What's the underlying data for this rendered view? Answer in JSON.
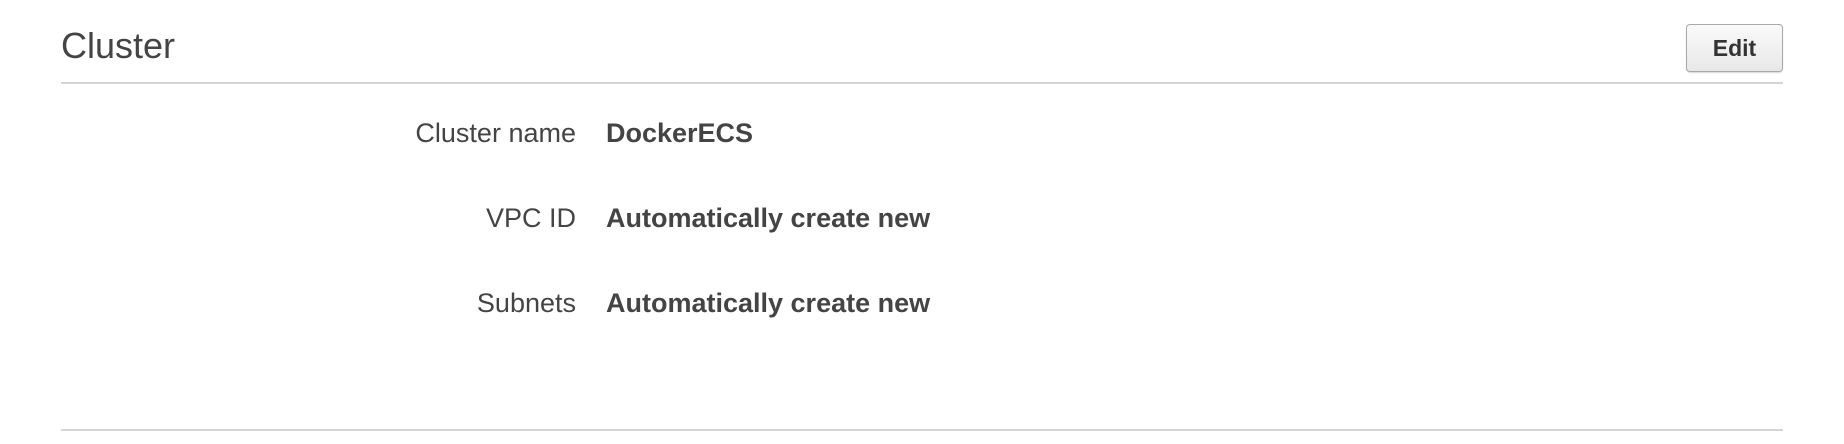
{
  "section": {
    "title": "Cluster",
    "edit_label": "Edit"
  },
  "fields": [
    {
      "label": "Cluster name",
      "value": "DockerECS"
    },
    {
      "label": "VPC ID",
      "value": "Automatically create new"
    },
    {
      "label": "Subnets",
      "value": "Automatically create new"
    }
  ],
  "colors": {
    "text": "#444444",
    "divider": "#d4d4d4",
    "button_border": "#a8a8a8"
  }
}
